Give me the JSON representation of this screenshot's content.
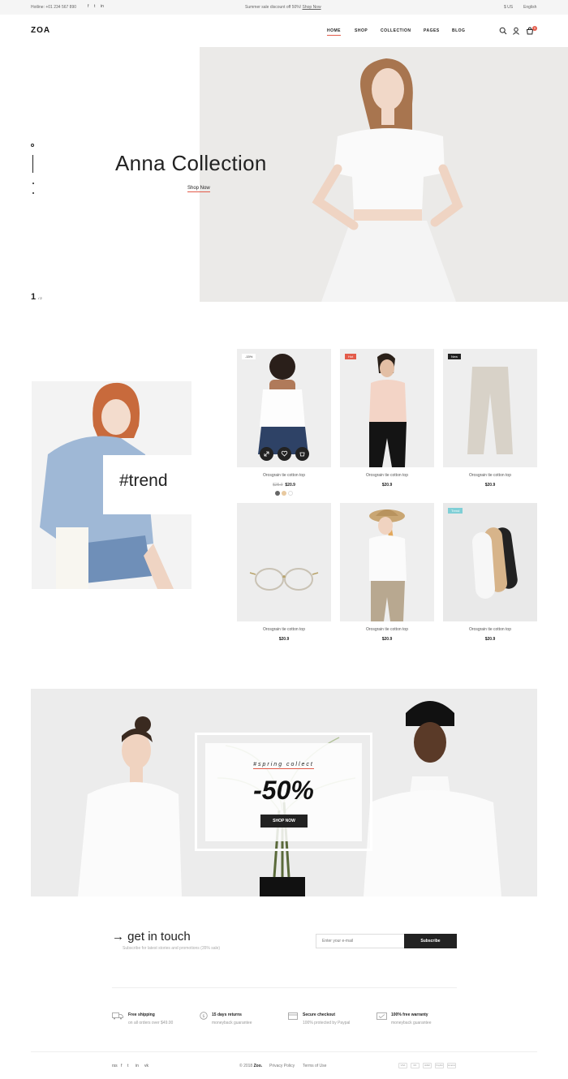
{
  "topbar": {
    "hotline": "Hotline: +01 234 567 890",
    "promo_text": "Summer sale discount off 50%!",
    "promo_link": "Shop Now",
    "currency": "$ US",
    "language": "English",
    "social": [
      "f",
      "t",
      "in"
    ]
  },
  "header": {
    "logo": "ZOA",
    "nav": [
      "HOME",
      "SHOP",
      "COLLECTION",
      "PAGES",
      "BLOG"
    ],
    "cart_count": "0"
  },
  "hero": {
    "title": "Anna Collection",
    "cta": "Shop Now",
    "page_current": "1",
    "page_total": "/ 2"
  },
  "trend": {
    "label": "#trend"
  },
  "products": [
    {
      "name": "Orosgrain tie cotton top",
      "price": "$20.9",
      "old_price": "$25.9",
      "tag": "-15%"
    },
    {
      "name": "Orosgrain tie cotton top",
      "price": "$20.9",
      "tag": "Hot"
    },
    {
      "name": "Orosgrain tie cotton top",
      "price": "$20.9",
      "tag": "New"
    },
    {
      "name": "Orosgrain tie cotton top",
      "price": "$20.9",
      "tag": ""
    },
    {
      "name": "Orosgrain tie cotton top",
      "price": "$20.9",
      "tag": ""
    },
    {
      "name": "Orosgrain tie cotton top",
      "price": "$20.9",
      "tag": "Trend"
    }
  ],
  "promo": {
    "kicker": "#spring collect",
    "discount": "-50%",
    "cta": "SHOP NOW"
  },
  "contact": {
    "title": "get in touch",
    "subtitle": "Subscribe for latest stories and promotions (35% sale)",
    "email_placeholder": "Enter your e-mail",
    "button": "Subscribe"
  },
  "features": [
    {
      "title": "Free shipping",
      "sub": "on all orders over $49.00"
    },
    {
      "title": "15 days returns",
      "sub": "moneyback guarantee"
    },
    {
      "title": "Secure checkout",
      "sub": "100% protected by Paypal"
    },
    {
      "title": "100% free warranty",
      "sub": "moneyback guarantee"
    }
  ],
  "footer": {
    "copyright": "© 2018",
    "brand": "Zoo.",
    "privacy": "Privacy Policy",
    "terms": "Terms of Use",
    "social": [
      "rss",
      "f",
      "t",
      "in",
      "vk"
    ],
    "payments": [
      "VISA",
      "MC",
      "AMEX",
      "PayPal",
      "Amazon"
    ]
  },
  "colors": {
    "accent": "#e35b4a",
    "dark": "#222222",
    "tag_hot": "#e35b4a",
    "tag_new": "#222222",
    "tag_trend": "#7fcfd6"
  }
}
